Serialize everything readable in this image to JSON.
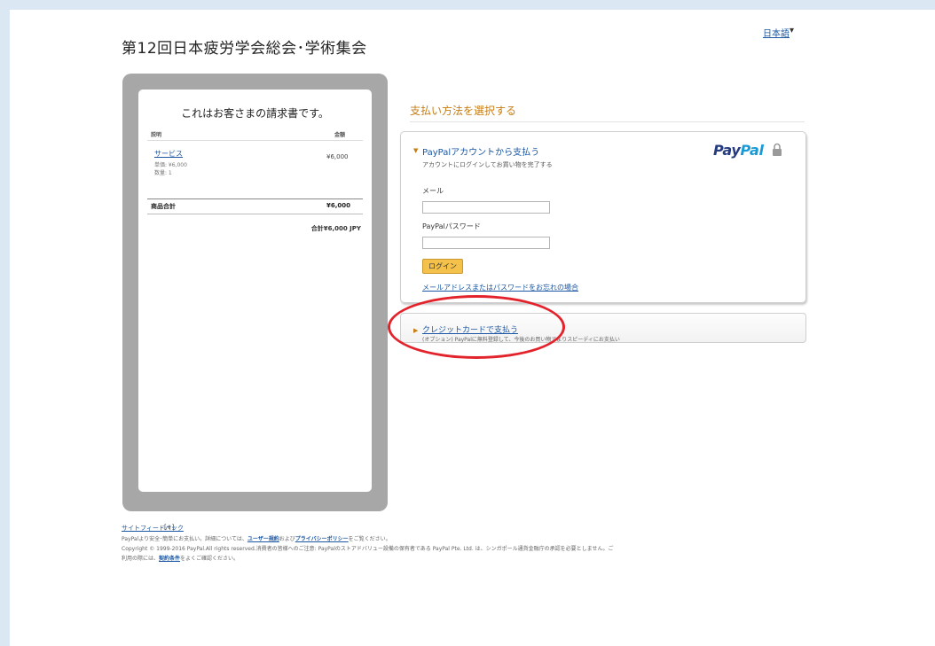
{
  "merchant_title": "第12回日本疲労学会総会･学術集会",
  "language": {
    "label": "日本語",
    "caret": "▾"
  },
  "invoice": {
    "title": "これはお客さまの請求書です。",
    "col_description": "説明",
    "col_amount": "金額",
    "item_name": "サービス",
    "item_unit_price": "単価: ¥6,000",
    "item_quantity": "数量: 1",
    "item_amount": "¥6,000",
    "subtotal_label": "商品合計",
    "subtotal_value": "¥6,000",
    "total": "合計¥6,000 JPY"
  },
  "payment": {
    "heading": "支払い方法を選択する",
    "paypal_option": {
      "title": "PayPalアカウントから支払う",
      "description": "アカウントにログインしてお買い物を完了する",
      "logo_pay": "Pay",
      "logo_pal": "Pal",
      "email_label": "メール",
      "email_value": "",
      "password_label": "PayPalパスワード",
      "login_button": "ログイン",
      "forgot_link": "メールアドレスまたはパスワードをお忘れの場合"
    },
    "card_option": {
      "title": "クレジットカードで支払う",
      "description": "(オプション) PayPalに無料登録して、今後のお買い物でよりスピーディにお支払い"
    }
  },
  "footer": {
    "feedback": "サイトフィードバック",
    "feedback_mark": "[+]",
    "line1_a": "PayPalより安全･簡単にお支払い。詳細については、",
    "line1_link1": "ユーザー規約",
    "line1_b": "および",
    "line1_link2": "プライバシーポリシー",
    "line1_c": "をご覧ください。",
    "line2": "Copyright © 1999-2016 PayPal.All rights reserved.消費者の皆様へのご注意: PayPalのストアドバリュー設備の保有者である PayPal Pte. Ltd. は、シンガポール通貨金融庁の承認を必要としません。ご",
    "line3_a": "利用の際には、",
    "line3_link": "契約条件",
    "line3_b": "をよくご確認ください。"
  },
  "colors": {
    "link": "#1b57a3",
    "accent_orange": "#c77d14",
    "login_button": "#f4c24a",
    "annotation_circle": "#e3232b",
    "paypal_dark": "#253b80",
    "paypal_light": "#179bd7"
  },
  "icons": [
    "lock-icon",
    "orange-triangle-icon"
  ]
}
